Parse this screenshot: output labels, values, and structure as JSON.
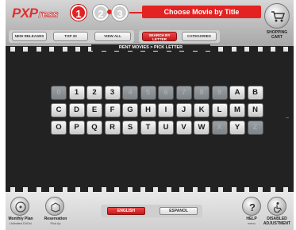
{
  "header": {
    "logo": {
      "main": "PXP",
      "press": "ress"
    },
    "steps": [
      "1",
      "2",
      "3"
    ],
    "step_title": "Choose Movie by Title",
    "cart": {
      "label_line1": "SHOPPING",
      "label_line2": "CART",
      "icon": "shopping-cart-icon"
    }
  },
  "nav": {
    "new_releases": "NEW RELEASES",
    "top_20": "TOP 20",
    "view_all": "VIEW ALL",
    "search_by_letter_line1": "SEARCH BY",
    "search_by_letter_line2": "LETTER",
    "categories": "CATEGORIES"
  },
  "breadcrumb": "RENT MOVIES > PICK LETTER",
  "keyboard": {
    "rows": [
      [
        {
          "k": "0",
          "enabled": false
        },
        {
          "k": "1",
          "enabled": true
        },
        {
          "k": "2",
          "enabled": true
        },
        {
          "k": "3",
          "enabled": true
        },
        {
          "k": "4",
          "enabled": false
        },
        {
          "k": "5",
          "enabled": false
        },
        {
          "k": "6",
          "enabled": false
        },
        {
          "k": "7",
          "enabled": false
        },
        {
          "k": "8",
          "enabled": false
        },
        {
          "k": "9",
          "enabled": false
        },
        {
          "k": "A",
          "enabled": true
        },
        {
          "k": "B",
          "enabled": true
        }
      ],
      [
        {
          "k": "C",
          "enabled": true
        },
        {
          "k": "D",
          "enabled": true
        },
        {
          "k": "E",
          "enabled": true
        },
        {
          "k": "F",
          "enabled": true
        },
        {
          "k": "G",
          "enabled": true
        },
        {
          "k": "H",
          "enabled": true
        },
        {
          "k": "I",
          "enabled": true
        },
        {
          "k": "J",
          "enabled": true
        },
        {
          "k": "K",
          "enabled": true
        },
        {
          "k": "L",
          "enabled": true
        },
        {
          "k": "M",
          "enabled": true
        },
        {
          "k": "N",
          "enabled": true
        }
      ],
      [
        {
          "k": "O",
          "enabled": true
        },
        {
          "k": "P",
          "enabled": true
        },
        {
          "k": "Q",
          "enabled": true
        },
        {
          "k": "R",
          "enabled": true
        },
        {
          "k": "S",
          "enabled": true
        },
        {
          "k": "T",
          "enabled": true
        },
        {
          "k": "U",
          "enabled": true
        },
        {
          "k": "V",
          "enabled": true
        },
        {
          "k": "W",
          "enabled": true
        },
        {
          "k": "X",
          "enabled": false
        },
        {
          "k": "Y",
          "enabled": true
        },
        {
          "k": "Z",
          "enabled": false
        }
      ]
    ]
  },
  "footer": {
    "monthly_plan": {
      "label": "Monthly Plan",
      "sub": "Unlimited DVDs!"
    },
    "reservation": {
      "label": "Reservation",
      "sub": "Pick Up"
    },
    "lang_english": "ENGLISH",
    "lang_espanol": "ESPANOL",
    "help": {
      "label": "HELP",
      "sub": "menu"
    },
    "disabled": {
      "label_line1": "DISABLED",
      "label_line2": "ADJUSTMENT"
    }
  },
  "colors": {
    "accent": "#e32222",
    "screen_bg": "#222222"
  }
}
